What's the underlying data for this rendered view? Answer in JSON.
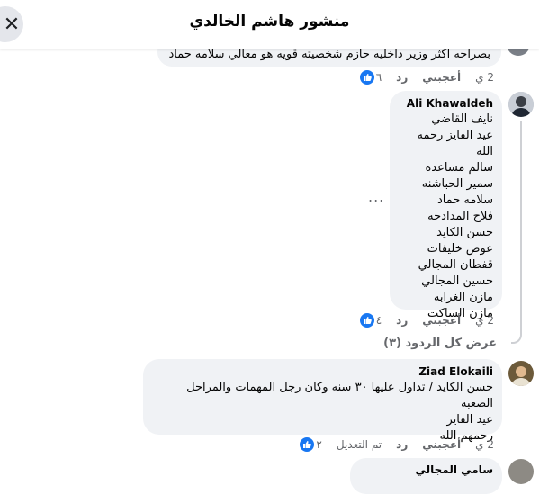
{
  "header": {
    "title": "منشور هاشم الخالدي",
    "close_glyph": "✕"
  },
  "comments": [
    {
      "text_lines": [
        "بصراحه اكثر وزير داخليه حازم شخصيته قويه هو معالي سلامه حماد"
      ],
      "time": "2 ي",
      "like_label": "أعجبني",
      "reply_label": "رد",
      "reactions": "٦"
    },
    {
      "author": "Ali Khawaldeh",
      "text_lines": [
        "نايف القاضي",
        "عيد الفايز رحمه الله",
        "سالم مساعده",
        "سمير الحباشنه",
        "سلامه حماد",
        "فلاح المدادحه",
        "حسن الكايد",
        "عوض خليفات",
        "قفطان المجالي",
        "حسين المجالي",
        "مازن الغرابه",
        "مازن الساكت"
      ],
      "time": "2 ي",
      "like_label": "أعجبني",
      "reply_label": "رد",
      "reactions": "٤",
      "more_glyph": "..."
    },
    {
      "author": "Ziad Elokaili",
      "text_lines": [
        "حسن الكايد / تداول عليها ٣٠ سنه وكان رجل المهمات والمراحل الصعبه",
        "عيد الفايز",
        "رحمهم الله"
      ],
      "time": "2 ي",
      "like_label": "أعجبني",
      "reply_label": "رد",
      "edited_label": "تم التعديل",
      "reactions": "٢"
    },
    {
      "author": "سامي المجالي"
    }
  ],
  "view_replies": "عرض كل الردود (٣)",
  "icons": {
    "like": "like-icon",
    "close": "close-icon",
    "more": "more-options-icon"
  },
  "colors": {
    "accent": "#1877f2",
    "bubble": "#f0f2f5",
    "muted": "#65676b"
  }
}
